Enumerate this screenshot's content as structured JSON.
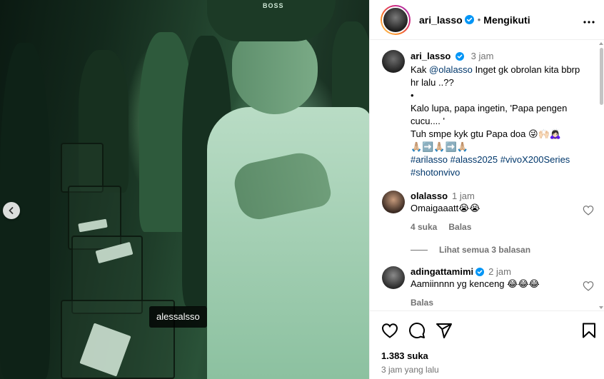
{
  "photo": {
    "cap_text": "BOSS",
    "tagged_user": "alessalsso"
  },
  "header": {
    "username": "ari_lasso",
    "separator": "•",
    "follow_status": "Mengikuti"
  },
  "caption": {
    "username": "ari_lasso",
    "time": "3 jam",
    "line1_prefix": "Kak ",
    "mention": "@olalasso",
    "line1_suffix": " Inget gk obrolan kita bbrp hr lalu ..??",
    "bullet": "•",
    "line2": "Kalo lupa, papa ingetin, 'Papa pengen cucu.... '",
    "line3": "Tuh smpe kyk gtu Papa doa 😜🙌🏻🙇🏻‍♀️",
    "line4": "🙏🏼➡️🙏🏼➡️🙏🏼",
    "hashtags": "#arilasso #alass2025 #vivoX200Series #shotonvivo"
  },
  "comments": [
    {
      "username": "olalasso",
      "time": "1 jam",
      "text": "Omaigaaatt😭😭",
      "likes": "4 suka",
      "reply": "Balas",
      "view_replies": "Lihat semua 3 balasan"
    },
    {
      "username": "adingattamimi",
      "time": "2 jam",
      "text": "Aamiinnnn yg kenceng 😂😂😂",
      "reply": "Balas"
    }
  ],
  "footer": {
    "likes": "1.383 suka",
    "posted": "3 jam yang lalu"
  },
  "colors": {
    "link": "#00376b",
    "verified": "#0095f6",
    "muted": "#737373"
  }
}
